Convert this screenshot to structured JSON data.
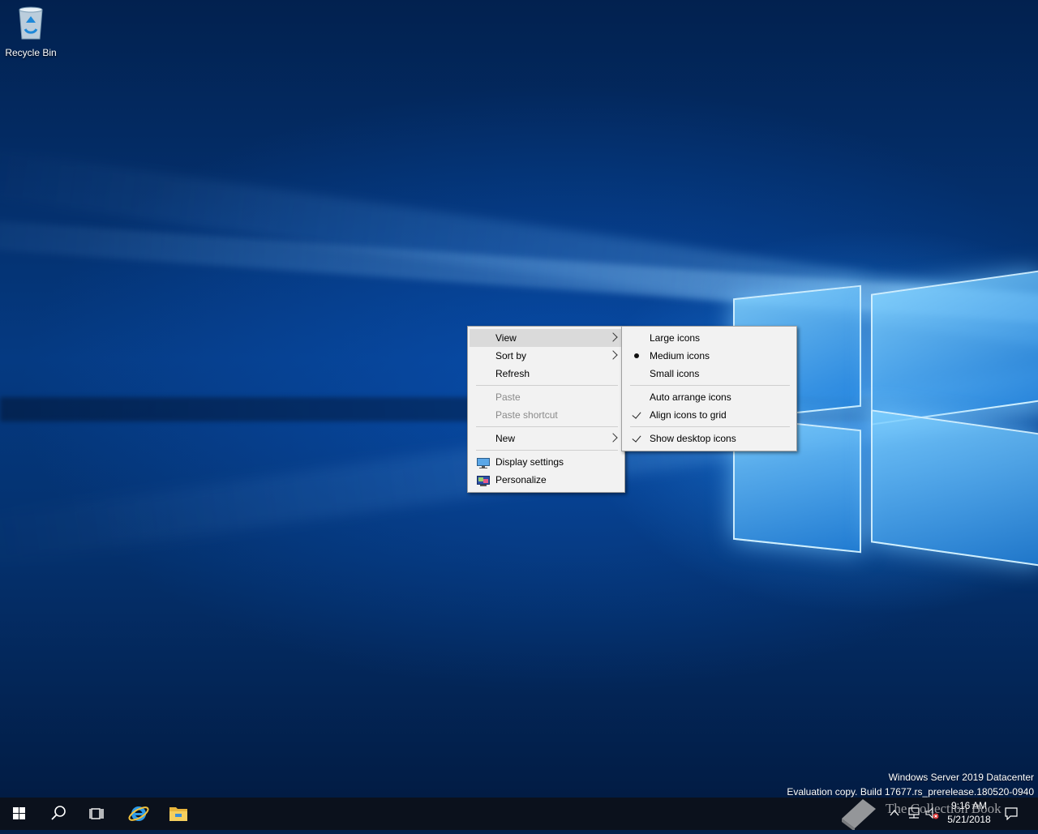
{
  "desktop": {
    "icons": [
      {
        "label": "Recycle Bin",
        "icon": "recycle-bin-icon"
      }
    ]
  },
  "context_menu": {
    "items": [
      {
        "label": "View",
        "state": "highlighted",
        "has_submenu": true
      },
      {
        "label": "Sort by",
        "has_submenu": true
      },
      {
        "label": "Refresh"
      },
      {
        "label": "Paste",
        "disabled": true
      },
      {
        "label": "Paste shortcut",
        "disabled": true
      },
      {
        "label": "New",
        "has_submenu": true
      },
      {
        "label": "Display settings",
        "icon": "display-settings-icon"
      },
      {
        "label": "Personalize",
        "icon": "personalize-icon"
      }
    ]
  },
  "view_submenu": {
    "items": [
      {
        "label": "Large icons"
      },
      {
        "label": "Medium icons",
        "marker": "bullet"
      },
      {
        "label": "Small icons"
      },
      {
        "label": "Auto arrange icons"
      },
      {
        "label": "Align icons to grid",
        "marker": "check"
      },
      {
        "label": "Show desktop icons",
        "marker": "check"
      }
    ]
  },
  "watermark": {
    "line1": "Windows Server 2019 Datacenter",
    "line2": "Evaluation copy. Build 17677.rs_prerelease.180520-0940"
  },
  "taskbar": {
    "buttons": [
      "start-icon",
      "search-icon",
      "task-view-icon",
      "internet-explorer-icon",
      "file-explorer-icon"
    ],
    "tray_icons": [
      "chevron-up-icon",
      "network-icon",
      "volume-icon",
      "notification-icon"
    ],
    "clock": {
      "time": "9:16 AM",
      "date": "5/21/2018"
    }
  },
  "overlay_text": "The Collection Book",
  "colors": {
    "taskbar": "#0b111c",
    "menu_bg": "#f2f2f2",
    "menu_highlight": "#dadada",
    "disabled_text": "#8a8a8a"
  }
}
